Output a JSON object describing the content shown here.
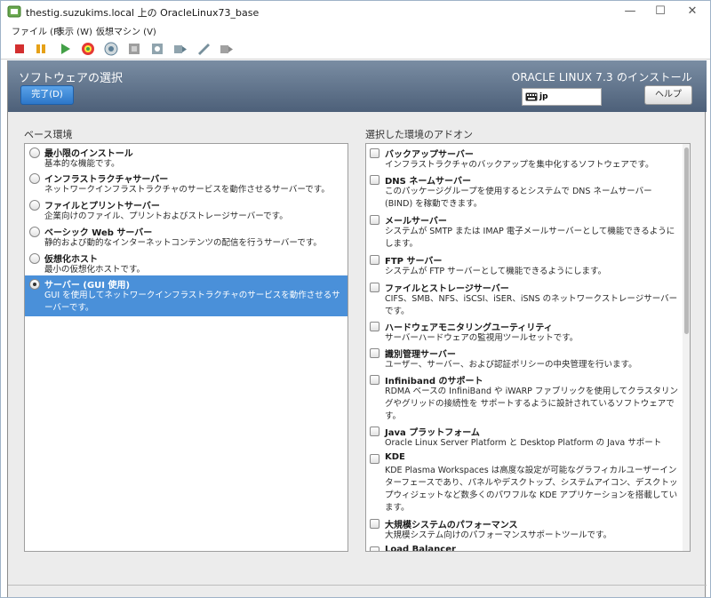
{
  "window": {
    "title": "thestig.suzukims.local 上の OracleLinux73_base",
    "controls": {
      "minimize": "—",
      "maximize": "☐",
      "close": "✕"
    }
  },
  "menu": [
    "ファイル (F)",
    "表示 (W)",
    "仮想マシン (V)"
  ],
  "toolbar": {
    "icons": [
      "stop-icon",
      "pause-icon",
      "play-icon",
      "reset-icon",
      "snapshot-icon",
      "snapshot-restore-icon",
      "snapshot-manager-icon",
      "send-keys-icon",
      "usb-icon",
      "settings-icon"
    ]
  },
  "banner": {
    "page_title": "ソフトウェアの選択",
    "done_label": "完了(D)",
    "install_title": "ORACLE LINUX 7.3 のインストール",
    "keyboard_layout": "jp",
    "help_label": "ヘルプ"
  },
  "base_env": {
    "heading": "ベース環境",
    "items": [
      {
        "name": "最小限のインストール",
        "desc": "基本的な機能です。",
        "selected": false
      },
      {
        "name": "インフラストラクチャサーバー",
        "desc": "ネットワークインフラストラクチャのサービスを動作させるサーバーです。",
        "selected": false
      },
      {
        "name": "ファイルとプリントサーバー",
        "desc": "企業向けのファイル、プリントおよびストレージサーバーです。",
        "selected": false
      },
      {
        "name": "ベーシック Web サーバー",
        "desc": "静的および動的なインターネットコンテンツの配信を行うサーバーです。",
        "selected": false
      },
      {
        "name": "仮想化ホスト",
        "desc": "最小の仮想化ホストです。",
        "selected": false
      },
      {
        "name": "サーバー (GUI 使用)",
        "desc": "GUI を使用してネットワークインフラストラクチャのサービスを動作させるサーバーです。",
        "selected": true
      }
    ]
  },
  "addons": {
    "heading": "選択した環境のアドオン",
    "items": [
      {
        "name": "バックアップサーバー",
        "desc": "インフラストラクチャのバックアップを集中化するソフトウェアです。",
        "checked": false
      },
      {
        "name": "DNS ネームサーバー",
        "desc": "このパッケージグループを使用するとシステムで DNS ネームサーバー (BIND) を稼動できます。",
        "checked": false
      },
      {
        "name": "メールサーバー",
        "desc": "システムが SMTP または IMAP 電子メールサーバーとして機能できるようにします。",
        "checked": false
      },
      {
        "name": "FTP サーバー",
        "desc": "システムが FTP サーバーとして機能できるようにします。",
        "checked": false
      },
      {
        "name": "ファイルとストレージサーバー",
        "desc": "CIFS、SMB、NFS、iSCSI、iSER、iSNS のネットワークストレージサーバーです。",
        "checked": false
      },
      {
        "name": "ハードウェアモニタリングユーティリティ",
        "desc": "サーバーハードウェアの監視用ツールセットです。",
        "checked": false
      },
      {
        "name": "識別管理サーバー",
        "desc": "ユーザー、サーバー、および認証ポリシーの中央管理を行います。",
        "checked": false
      },
      {
        "name": "Infiniband のサポート",
        "desc": "RDMA ベースの InfiniBand や iWARP ファブリックを使用してクラスタリングやグリッドの接続性を サポートするように設計されているソフトウェアです。",
        "checked": false
      },
      {
        "name": "Java プラットフォーム",
        "desc": "Oracle Linux Server Platform と Desktop Platform の Java サポート",
        "checked": false
      },
      {
        "name": "KDE",
        "desc": "KDE Plasma Workspaces は高度な設定が可能なグラフィカルユーザーインターフェースであり、パネルやデスクトップ、システムアイコン、デスクトップウィジェットなど数多くのパワフルな KDE アプリケーションを搭載しています。",
        "checked": false
      },
      {
        "name": "大規模システムのパフォーマンス",
        "desc": "大規模システム向けのパフォーマンスサポートツールです。",
        "checked": false
      },
      {
        "name": "Load Balancer",
        "desc": "",
        "checked": false
      }
    ]
  }
}
